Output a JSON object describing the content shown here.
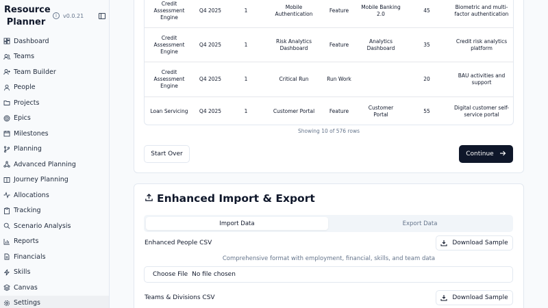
{
  "app": {
    "title": "Resource Planner",
    "version": "v0.0.21"
  },
  "sidebar": {
    "items": [
      {
        "label": "Dashboard",
        "icon": "dashboard-icon"
      },
      {
        "label": "Teams",
        "icon": "users-icon"
      },
      {
        "label": "Team Builder",
        "icon": "user-plus-icon"
      },
      {
        "label": "People",
        "icon": "person-icon"
      },
      {
        "label": "Projects",
        "icon": "folder-icon"
      },
      {
        "label": "Epics",
        "icon": "target-icon"
      },
      {
        "label": "Milestones",
        "icon": "calendar-icon"
      },
      {
        "label": "Planning",
        "icon": "branch-icon"
      },
      {
        "label": "Advanced Planning",
        "icon": "network-icon"
      },
      {
        "label": "Journey Planning",
        "icon": "book-icon"
      },
      {
        "label": "Allocations",
        "icon": "activity-icon"
      },
      {
        "label": "Tracking",
        "icon": "clipboard-icon"
      },
      {
        "label": "Scenario Analysis",
        "icon": "search-icon"
      },
      {
        "label": "Reports",
        "icon": "bar-chart-icon"
      },
      {
        "label": "Financials",
        "icon": "file-icon"
      },
      {
        "label": "Skills",
        "icon": "zap-icon"
      },
      {
        "label": "Canvas",
        "icon": "layers-icon"
      },
      {
        "label": "Settings",
        "icon": "gear-icon",
        "active": true
      }
    ]
  },
  "table": {
    "rows": [
      [
        "Credit Assessment Engine",
        "Q4 2025",
        "1",
        "Mobile Authentication",
        "Feature",
        "Mobile Banking 2.0",
        "45",
        "Biometric and multi-factor authentication"
      ],
      [
        "Credit Assessment Engine",
        "Q4 2025",
        "1",
        "Risk Analytics Dashboard",
        "Feature",
        "Analytics Dashboard",
        "35",
        "Credit risk analytics platform"
      ],
      [
        "Credit Assessment Engine",
        "Q4 2025",
        "1",
        "Critical Run",
        "Run Work",
        "",
        "20",
        "BAU activities and support"
      ],
      [
        "Loan Servicing",
        "Q4 2025",
        "1",
        "Customer Portal",
        "Feature",
        "Customer Portal",
        "55",
        "Digital customer self-service portal"
      ]
    ],
    "showing": "Showing 10 of 576 rows"
  },
  "actions": {
    "start_over": "Start Over",
    "continue": "Continue"
  },
  "import_export": {
    "title": "Enhanced Import & Export",
    "tabs": [
      "Import Data",
      "Export Data"
    ],
    "people_label": "Enhanced People CSV",
    "download_sample": "Download Sample",
    "people_desc": "Comprehensive format with employment, financial, skills, and team data",
    "choose_file": "Choose File",
    "no_file": "No file chosen",
    "teams_label": "Teams & Divisions CSV"
  },
  "colors": {
    "primary": "#0f172a",
    "muted": "#64748b",
    "border": "#e2e8f0",
    "sidebar_active": "#eef0f3"
  }
}
